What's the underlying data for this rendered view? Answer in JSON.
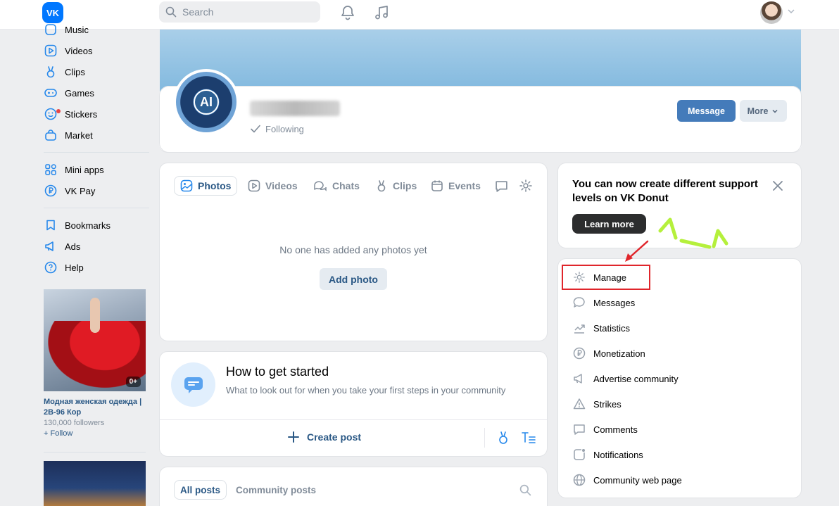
{
  "topbar": {
    "logo_text": "VK",
    "search_placeholder": "Search"
  },
  "sidebar": {
    "items": [
      {
        "label": "Music",
        "icon": "music-note-icon"
      },
      {
        "label": "Videos",
        "icon": "video-play-icon"
      },
      {
        "label": "Clips",
        "icon": "clips-icon"
      },
      {
        "label": "Games",
        "icon": "gamepad-icon"
      },
      {
        "label": "Stickers",
        "icon": "smile-icon"
      },
      {
        "label": "Market",
        "icon": "shopping-bag-icon"
      },
      {
        "label": "Mini apps",
        "icon": "apps-grid-icon"
      },
      {
        "label": "VK Pay",
        "icon": "ruble-circle-icon"
      },
      {
        "label": "Bookmarks",
        "icon": "bookmark-icon"
      },
      {
        "label": "Ads",
        "icon": "megaphone-icon"
      },
      {
        "label": "Help",
        "icon": "help-circle-icon"
      }
    ],
    "ad": {
      "badge": "0+",
      "title": "Модная женская одежда | 2B-96 Кор",
      "followers": "130,000 followers",
      "follow_label": "+ Follow"
    }
  },
  "header": {
    "avatar_text": "AI",
    "status": "Following",
    "message_button": "Message",
    "more_button": "More"
  },
  "content_tabs": {
    "tabs": [
      "Photos",
      "Videos",
      "Chats",
      "Clips",
      "Events"
    ],
    "active": "Photos",
    "empty_text": "No one has added any photos yet",
    "add_photo": "Add photo"
  },
  "getting_started": {
    "title": "How to get started",
    "subtitle": "What to look out for when you take your first steps in your community",
    "create_post": "Create post"
  },
  "posts_tabs": {
    "all_posts": "All posts",
    "community_posts": "Community posts"
  },
  "donut": {
    "title": "You can now create different support levels on VK Donut",
    "learn_more": "Learn more"
  },
  "manage_menu": {
    "items": [
      {
        "label": "Manage",
        "icon": "gear-icon"
      },
      {
        "label": "Messages",
        "icon": "message-bubble-icon"
      },
      {
        "label": "Statistics",
        "icon": "trend-chart-icon"
      },
      {
        "label": "Monetization",
        "icon": "ruble-circle-icon"
      },
      {
        "label": "Advertise community",
        "icon": "megaphone-icon"
      },
      {
        "label": "Strikes",
        "icon": "warning-triangle-icon"
      },
      {
        "label": "Comments",
        "icon": "comment-icon"
      },
      {
        "label": "Notifications",
        "icon": "notification-square-icon"
      },
      {
        "label": "Community web page",
        "icon": "globe-icon"
      }
    ]
  },
  "colors": {
    "accent": "#447bba",
    "link": "#2a5885",
    "highlight": "#e0252b",
    "annotation": "#b5f03c"
  }
}
